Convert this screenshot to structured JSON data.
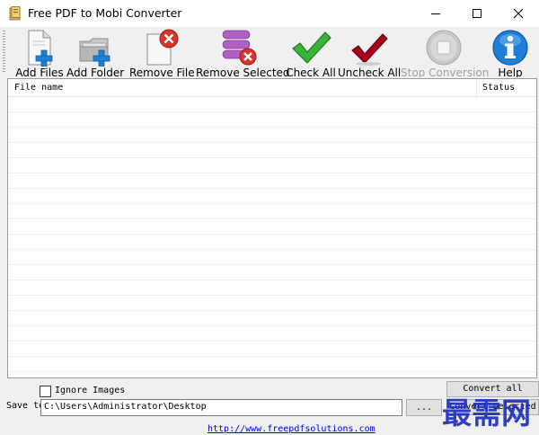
{
  "window": {
    "title": "Free PDF to Mobi Converter"
  },
  "toolbar": {
    "items": [
      {
        "label": "Add Files",
        "icon": "add-files-icon",
        "enabled": true
      },
      {
        "label": "Add Folder",
        "icon": "add-folder-icon",
        "enabled": true
      },
      {
        "label": "Remove File",
        "icon": "remove-file-icon",
        "enabled": true
      },
      {
        "label": "Remove Selected",
        "icon": "remove-selected-icon",
        "enabled": true
      },
      {
        "label": "Check All",
        "icon": "check-all-icon",
        "enabled": true
      },
      {
        "label": "Uncheck All",
        "icon": "uncheck-all-icon",
        "enabled": true
      },
      {
        "label": "Stop Conversion",
        "icon": "stop-conversion-icon",
        "enabled": false
      },
      {
        "label": "Help",
        "icon": "help-icon",
        "enabled": true
      }
    ]
  },
  "file_list": {
    "columns": [
      "File name",
      "Status"
    ],
    "rows": []
  },
  "options": {
    "ignore_images_label": "Ignore Images",
    "ignore_images_checked": false
  },
  "output": {
    "save_to_label": "Save to",
    "save_to_value": "C:\\Users\\Administrator\\Desktop",
    "browse_label": "..."
  },
  "actions": {
    "convert_all_label": "Convert all",
    "convert_selected_label": "Convert selected"
  },
  "footer": {
    "link_text": "http://www.freepdfsolutions.com"
  },
  "watermark": {
    "text": "最需网"
  },
  "colors": {
    "accent_blue": "#1e7fd8",
    "check_green": "#3bb33b",
    "uncheck_red": "#a8001c",
    "remove_red": "#d9342b",
    "stack_purple": "#b05fc4",
    "watermark_blue": "#1a2bbf"
  }
}
